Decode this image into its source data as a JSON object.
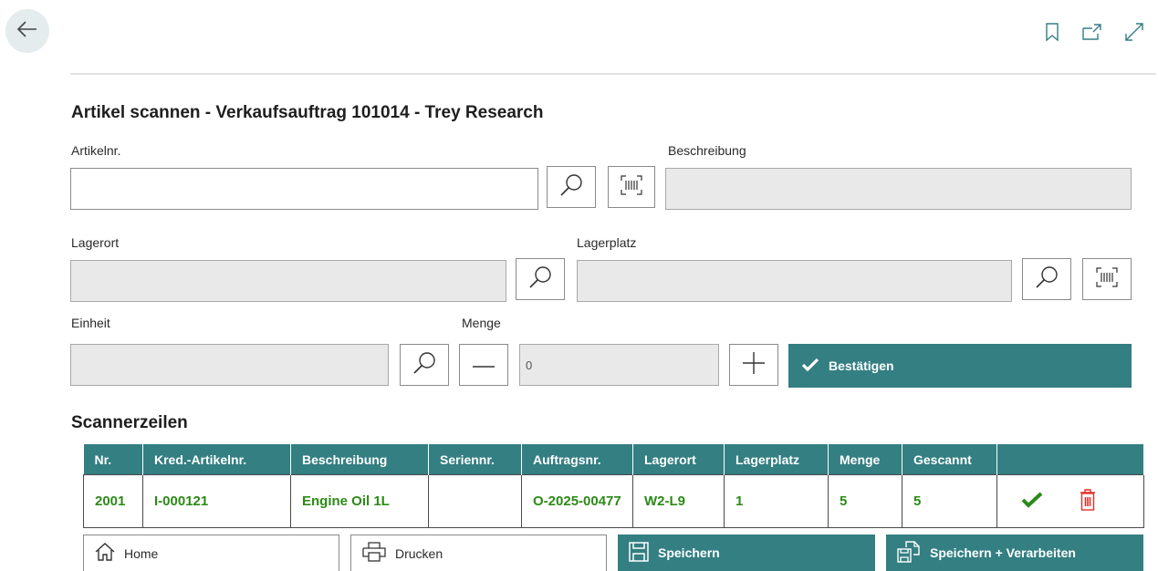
{
  "header": {
    "back_icon": "arrow-left-icon",
    "bookmark_icon": "bookmark-icon",
    "open_new_icon": "open-in-new-window-icon",
    "expand_icon": "expand-icon"
  },
  "title": "Artikel scannen - Verkaufsauftrag 101014 - Trey Research",
  "form": {
    "artikelnr": {
      "label": "Artikelnr.",
      "value": ""
    },
    "beschreibung": {
      "label": "Beschreibung",
      "value": ""
    },
    "lagerort": {
      "label": "Lagerort",
      "value": ""
    },
    "lagerplatz": {
      "label": "Lagerplatz",
      "value": ""
    },
    "einheit": {
      "label": "Einheit",
      "value": ""
    },
    "menge": {
      "label": "Menge",
      "value": "0"
    },
    "confirm_label": "Bestätigen"
  },
  "scanner": {
    "title": "Scannerzeilen",
    "columns": [
      "Nr.",
      "Kred.-Artikelnr.",
      "Beschreibung",
      "Seriennr.",
      "Auftragsnr.",
      "Lagerort",
      "Lagerplatz",
      "Menge",
      "Gescannt",
      ""
    ],
    "rows": [
      {
        "nr": "2001",
        "kred_artikelnr": "I-000121",
        "beschreibung": "Engine Oil 1L",
        "seriennr": "",
        "auftragsnr": "O-2025-00477",
        "lagerort": "W2-L9",
        "lagerplatz": "1",
        "menge": "5",
        "gescannt": "5"
      }
    ]
  },
  "buttons": {
    "home": "Home",
    "drucken": "Drucken",
    "speichern": "Speichern",
    "speichern_verarbeiten": "Speichern + Verarbeiten"
  },
  "colors": {
    "accent": "#337f82",
    "row_text": "#2c8a17",
    "check": "#2a8a1a",
    "delete": "#e0302a"
  }
}
